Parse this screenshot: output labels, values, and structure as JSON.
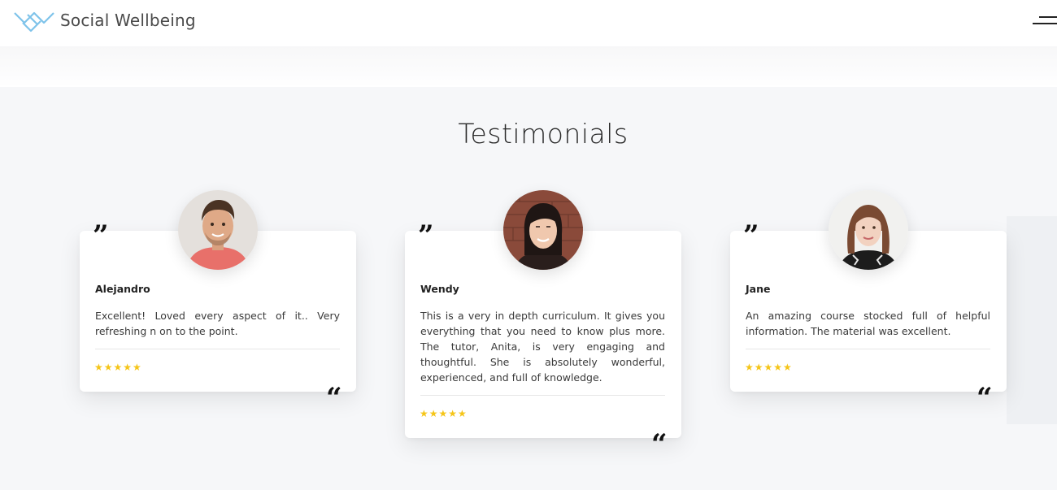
{
  "header": {
    "brand": "Social Wellbeing",
    "logo_icon": "chevron-logo-icon",
    "menu_icon": "hamburger-menu-icon"
  },
  "testimonials": {
    "title": "Testimonials",
    "open_quote": "”",
    "close_quote": "“",
    "items": [
      {
        "name": "Alejandro",
        "text": "Excellent! Loved every aspect of it.. Very refreshing n on to the point.",
        "stars": "★★★★★",
        "rating": 5
      },
      {
        "name": "Wendy",
        "text": "This is a very in depth curriculum. It gives you everything that you need to know plus more. The tutor, Anita, is very engaging and thoughtful. She is absolutely wonderful, experienced, and full of knowledge.",
        "stars": "★★★★★",
        "rating": 5
      },
      {
        "name": "Jane",
        "text": "An amazing course stocked full of helpful information. The material was excellent.",
        "stars": "★★★★★",
        "rating": 5
      }
    ]
  },
  "colors": {
    "accent_logo": "#7ec3ea",
    "star": "#f5c518",
    "section_bg": "#f6f7f9"
  }
}
